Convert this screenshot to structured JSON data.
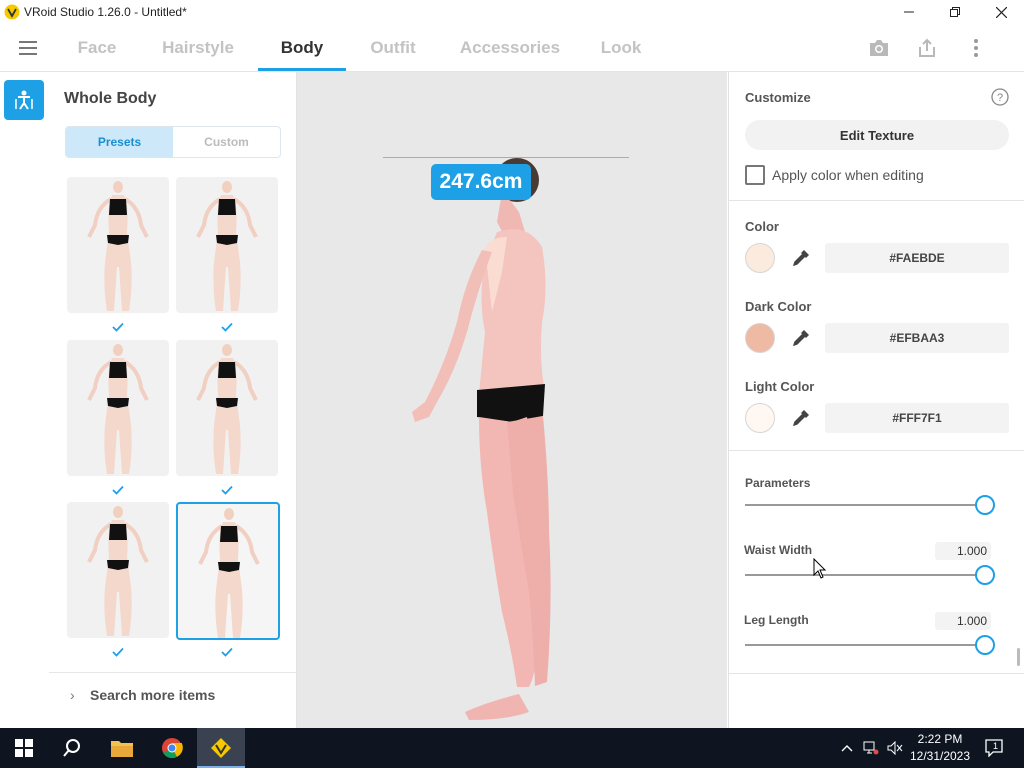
{
  "window": {
    "title": "VRoid Studio 1.26.0 - Untitled*"
  },
  "nav": {
    "tabs": [
      {
        "label": "Face"
      },
      {
        "label": "Hairstyle"
      },
      {
        "label": "Body"
      },
      {
        "label": "Outfit"
      },
      {
        "label": "Accessories"
      },
      {
        "label": "Look"
      }
    ],
    "active_tab": "Body",
    "icons": [
      "menu-icon",
      "camera-icon",
      "export-icon",
      "more-vert-icon"
    ]
  },
  "left_rail": {
    "icon": "body-figure-icon"
  },
  "presets_panel": {
    "title": "Whole Body",
    "segment": {
      "presets": "Presets",
      "custom": "Custom",
      "selected": "Presets"
    },
    "thumbnails": [
      {
        "checked": true,
        "selected": false
      },
      {
        "checked": true,
        "selected": false
      },
      {
        "checked": true,
        "selected": false
      },
      {
        "checked": true,
        "selected": false
      },
      {
        "checked": true,
        "selected": false
      },
      {
        "checked": true,
        "selected": true
      }
    ],
    "search_more": "Search more items"
  },
  "viewport": {
    "height_label": "247.6cm"
  },
  "customize": {
    "title": "Customize",
    "edit_texture": "Edit Texture",
    "apply_color_label": "Apply color when editing",
    "apply_color_checked": false
  },
  "colors": {
    "color": {
      "label": "Color",
      "hex": "#FAEBDE"
    },
    "dark_color": {
      "label": "Dark Color",
      "hex": "#EFBAA3"
    },
    "light_color": {
      "label": "Light Color",
      "hex": "#FFF7F1"
    }
  },
  "parameters": {
    "title": "Parameters",
    "top_slider_level": 1.0,
    "items": [
      {
        "label": "Waist Width",
        "value": "1.000",
        "level": 1.0
      },
      {
        "label": "Leg Length",
        "value": "1.000",
        "level": 1.0
      }
    ]
  },
  "taskbar": {
    "apps": [
      "windows-start-icon",
      "search-icon",
      "file-explorer-icon",
      "chrome-icon",
      "vroid-studio-icon"
    ],
    "time": "2:22 PM",
    "date": "12/31/2023",
    "notification_count": "1"
  },
  "accent_color": "#1EA0E6"
}
